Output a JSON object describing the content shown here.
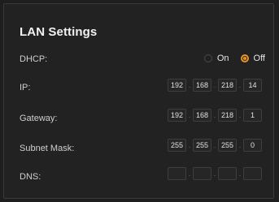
{
  "title": "LAN Settings",
  "dhcp": {
    "label": "DHCP:",
    "options": [
      {
        "label": "On",
        "selected": false
      },
      {
        "label": "Off",
        "selected": true
      }
    ]
  },
  "fields": {
    "ip": {
      "label": "IP:",
      "octets": [
        "192",
        "168",
        "218",
        "14"
      ]
    },
    "gateway": {
      "label": "Gateway:",
      "octets": [
        "192",
        "168",
        "218",
        "1"
      ]
    },
    "subnet": {
      "label": "Subnet Mask:",
      "octets": [
        "255",
        "255",
        "255",
        "0"
      ]
    },
    "dns": {
      "label": "DNS:",
      "octets": [
        "",
        "",
        "",
        ""
      ]
    }
  },
  "separator": ".",
  "colors": {
    "accent": "#e8932c",
    "panel": "#222222",
    "text": "#cfcfcf"
  }
}
